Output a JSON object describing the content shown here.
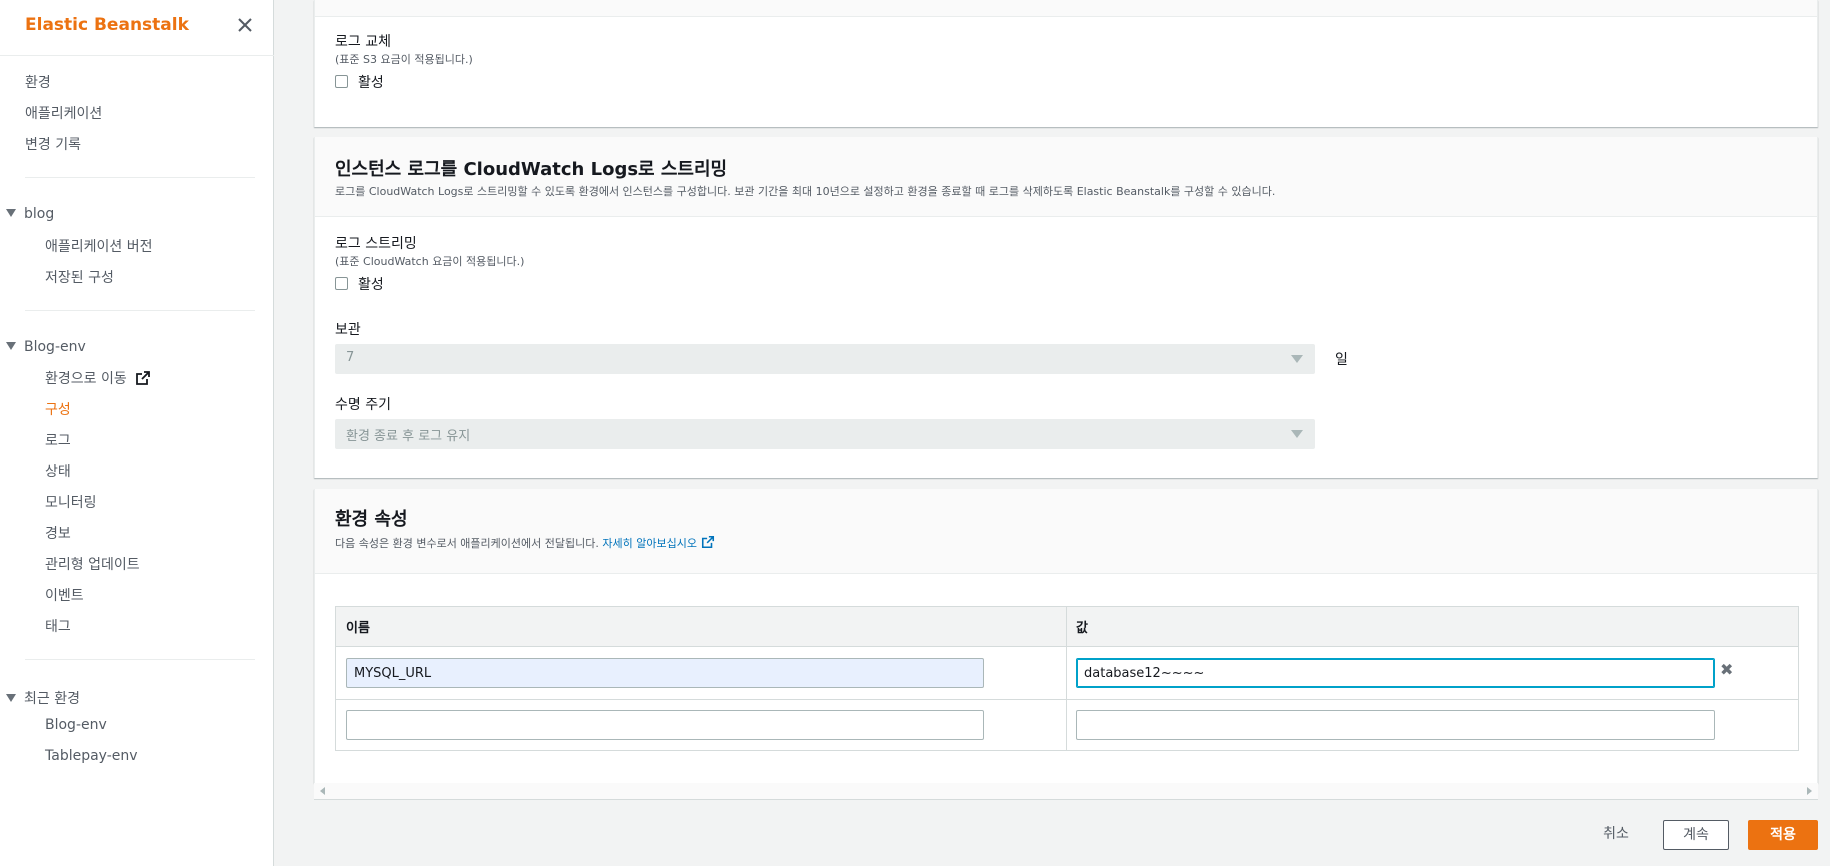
{
  "sidebar": {
    "title": "Elastic Beanstalk",
    "top_links": [
      "환경",
      "애플리케이션",
      "변경 기록"
    ],
    "app_group": {
      "name": "blog",
      "items": [
        "애플리케이션 버전",
        "저장된 구성"
      ]
    },
    "env_group": {
      "name": "Blog-env",
      "items": [
        "환경으로 이동",
        "구성",
        "로그",
        "상태",
        "모니터링",
        "경보",
        "관리형 업데이트",
        "이벤트",
        "태그"
      ],
      "active": "구성"
    },
    "recent_group": {
      "name": "최근 환경",
      "items": [
        "Blog-env",
        "Tablepay-env"
      ]
    }
  },
  "log_rotation": {
    "label": "로그 교체",
    "note": "(표준 S3 요금이 적용됩니다.)",
    "checkbox_label": "활성"
  },
  "cloudwatch": {
    "title": "인스턴스 로그를 CloudWatch Logs로 스트리밍",
    "description": "로그를 CloudWatch Logs로 스트리밍할 수 있도록 환경에서 인스턴스를 구성합니다. 보관 기간을 최대 10년으로 설정하고 환경을 종료할 때 로그를 삭제하도록 Elastic Beanstalk를 구성할 수 있습니다.",
    "streaming_label": "로그 스트리밍",
    "streaming_note": "(표준 CloudWatch 요금이 적용됩니다.)",
    "checkbox_label": "활성",
    "retention_label": "보관",
    "retention_value": "7",
    "retention_unit": "일",
    "lifecycle_label": "수명 주기",
    "lifecycle_value": "환경 종료 후 로그 유지"
  },
  "env_props": {
    "title": "환경 속성",
    "description": "다음 속성은 환경 변수로서 애플리케이션에서 전달됩니다.",
    "learn_more": "자세히 알아보십시오",
    "col_name": "이름",
    "col_value": "값",
    "rows": [
      {
        "name": "MYSQL_URL",
        "value": "database12~~~~"
      },
      {
        "name": "",
        "value": ""
      }
    ]
  },
  "footer": {
    "cancel": "취소",
    "continue": "계속",
    "apply": "적용"
  },
  "colors": {
    "accent": "#ec7211",
    "link": "#0073bb"
  }
}
